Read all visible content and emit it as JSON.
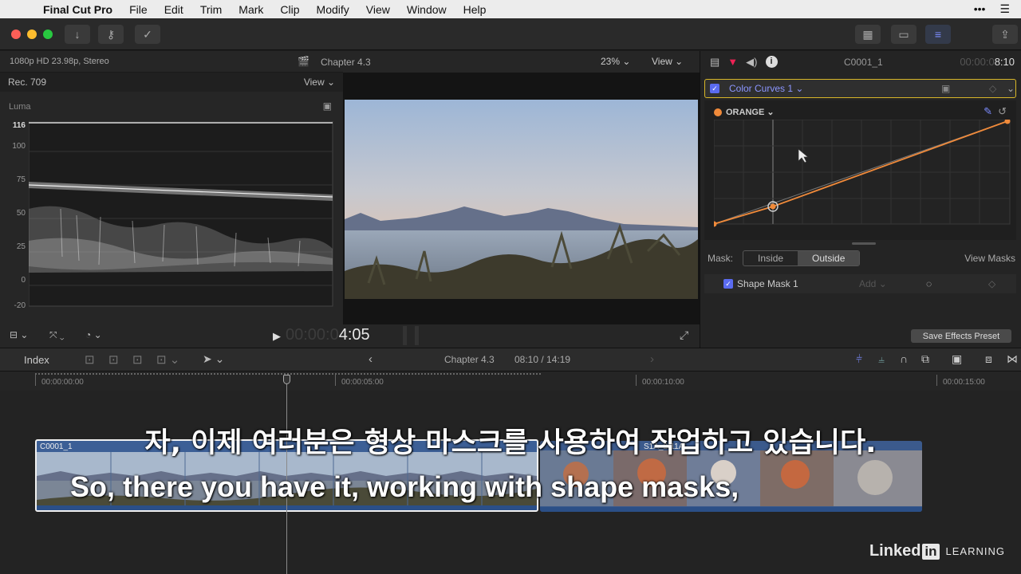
{
  "menubar": {
    "app": "Final Cut Pro",
    "items": [
      "File",
      "Edit",
      "Trim",
      "Mark",
      "Clip",
      "Modify",
      "View",
      "Window",
      "Help"
    ]
  },
  "scopes": {
    "format": "1080p HD 23.98p, Stereo",
    "colorspace": "Rec. 709",
    "view_label": "View",
    "scope_label": "Luma",
    "y_ticks": [
      "116",
      "100",
      "75",
      "50",
      "25",
      "0",
      "-20"
    ]
  },
  "viewer": {
    "project": "Chapter 4.3",
    "zoom": "23%",
    "view_label": "View",
    "timecode_dim": "00:00:0",
    "timecode": "4:05"
  },
  "inspector": {
    "clip_name": "C0001_1",
    "time_dim": "00:00:0",
    "time": "8:10",
    "effect_name": "Color Curves 1",
    "curve_name": "ORANGE",
    "mask_label": "Mask:",
    "mask_inside": "Inside",
    "mask_outside": "Outside",
    "view_masks": "View Masks",
    "shape_mask": "Shape Mask 1",
    "add_label": "Add",
    "save_preset": "Save Effects Preset"
  },
  "timeline_bar": {
    "index": "Index",
    "project": "Chapter 4.3",
    "duration": "08:10 / 14:19"
  },
  "ruler": {
    "marks": [
      "00:00:00:00",
      "00:00:05:00",
      "00:00:10:00",
      "00:00:15:00"
    ]
  },
  "clips": {
    "clip_a": "C0001_1",
    "clip_b": "S1A_2-11A"
  },
  "subtitles": {
    "korean": "자, 이제 여러분은 형상 마스크를 사용하여 작업하고 있습니다.",
    "english": "So, there you have it, working with shape masks,"
  },
  "branding": {
    "linked": "Linked",
    "in": "in",
    "learning": "LEARNING"
  },
  "colors": {
    "accent": "#7c8cff",
    "selection_yellow": "#d8b628",
    "curve_orange": "#f08a3a",
    "clip_blue": "#3c5f96"
  }
}
